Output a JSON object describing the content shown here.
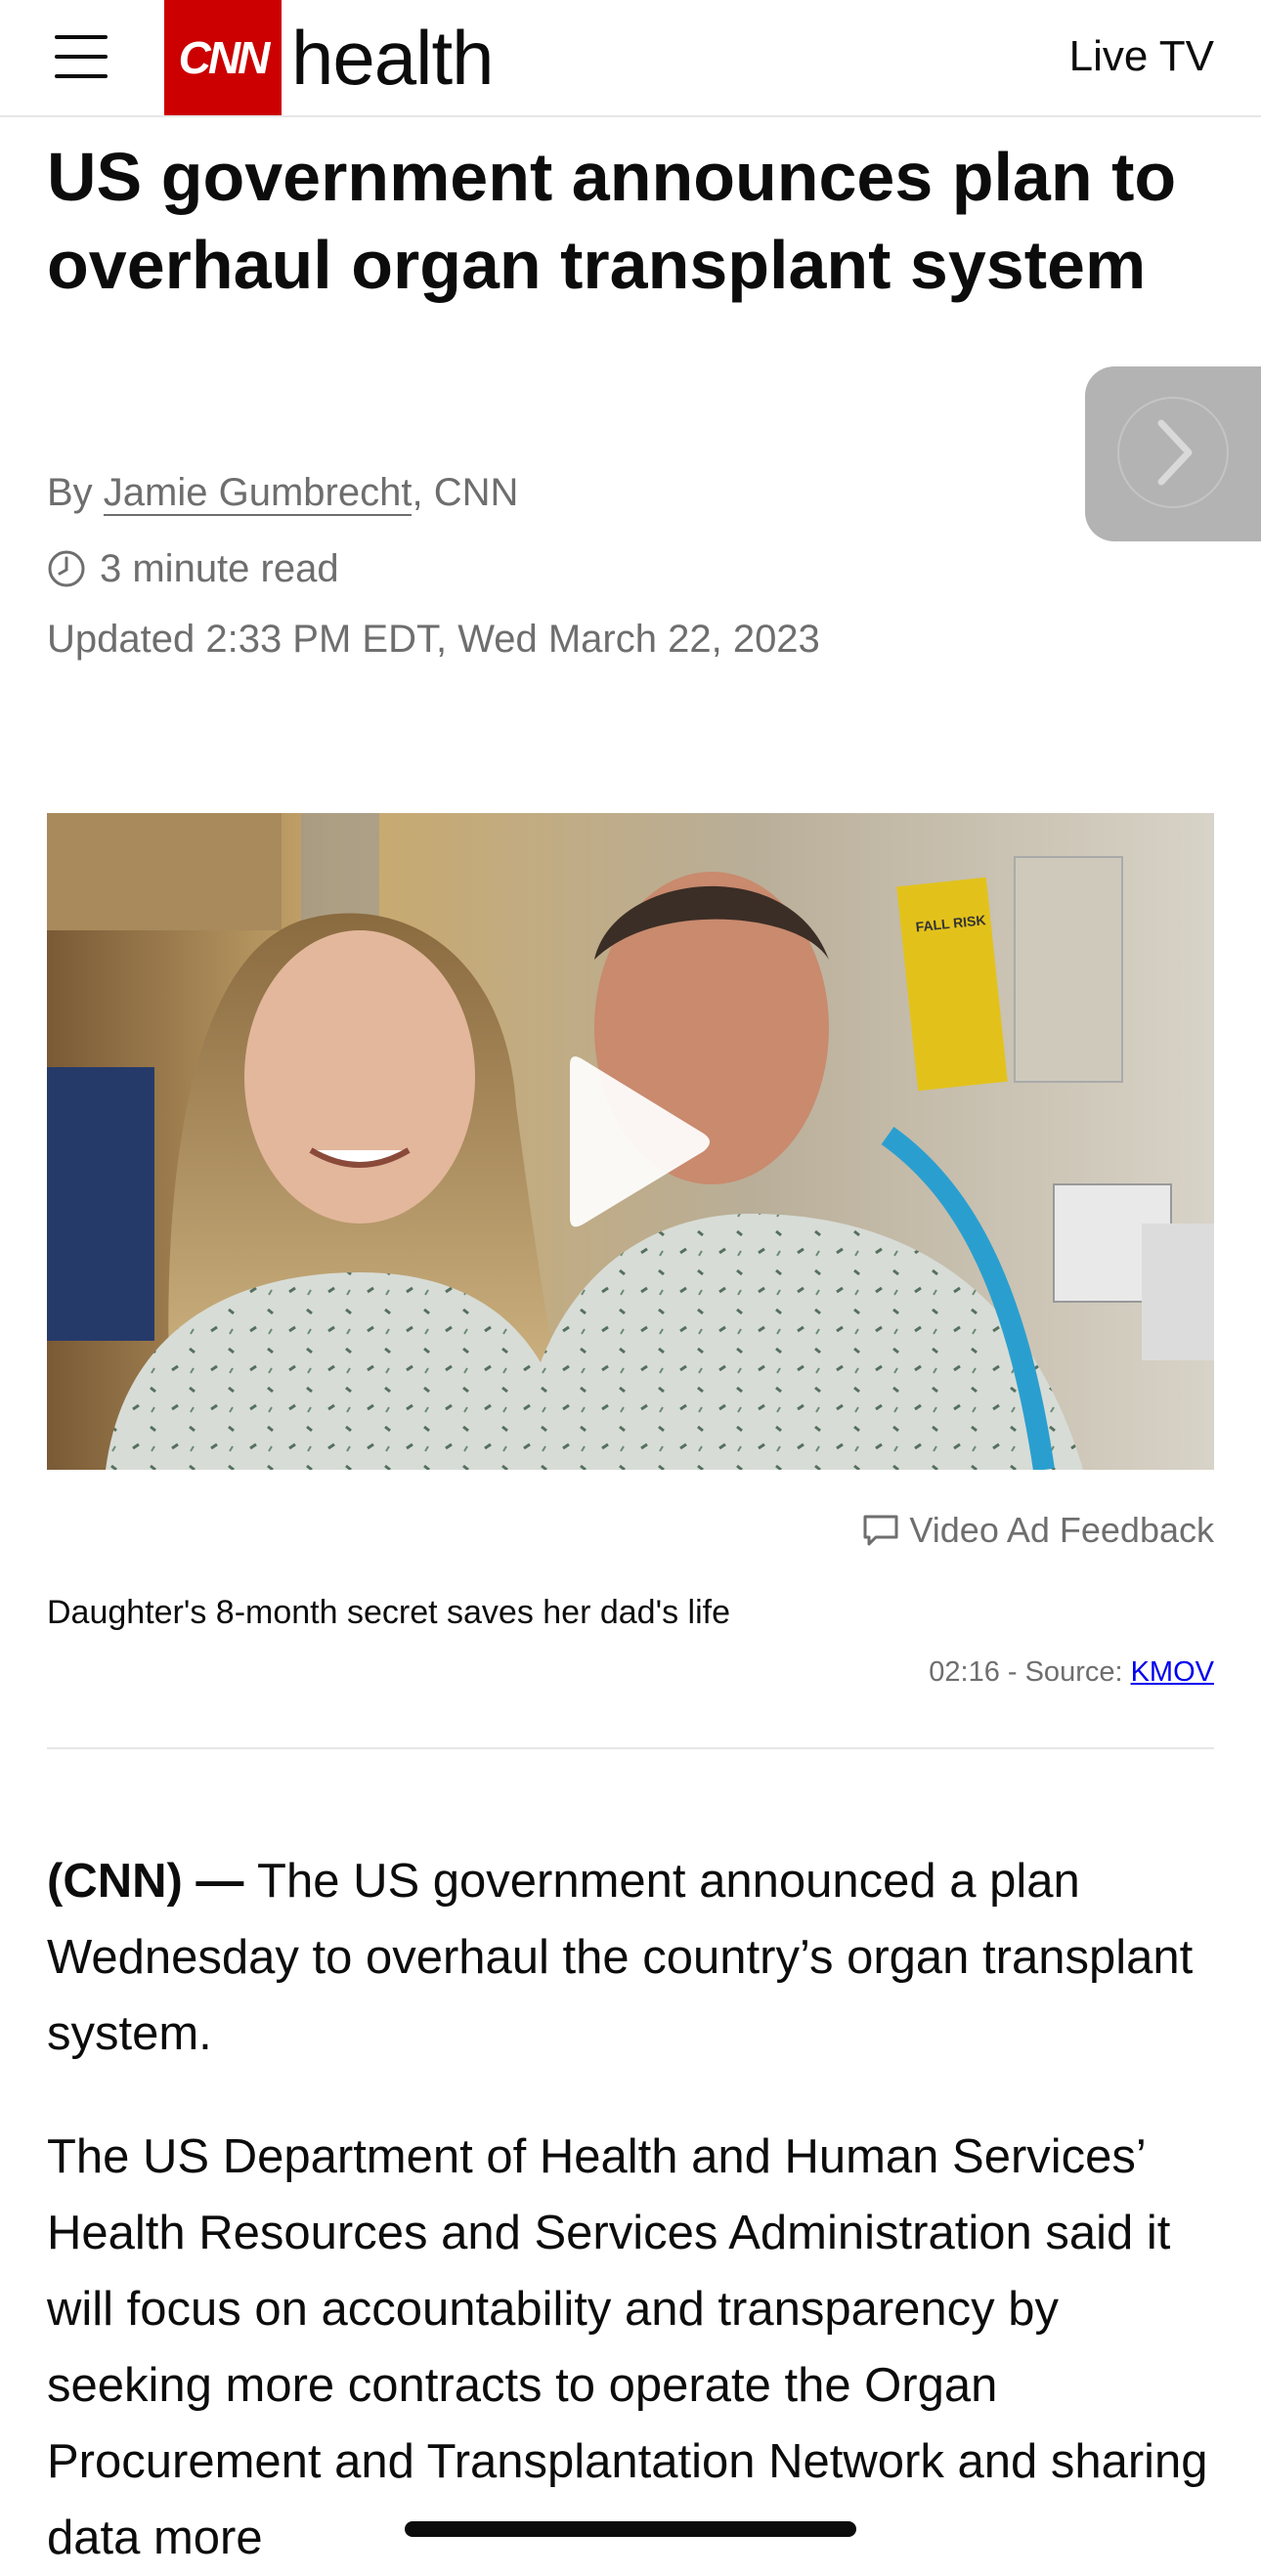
{
  "header": {
    "logo_text": "CNN",
    "section": "health",
    "live_tv": "Live TV",
    "brand_color": "#cc0000"
  },
  "article": {
    "headline": "US government announces plan to overhaul organ transplant system",
    "byline_prefix": "By ",
    "author": "Jamie Gumbrecht",
    "byline_suffix": ", CNN",
    "read_time": "3 minute read",
    "updated": "Updated 2:33 PM EDT, Wed March 22, 2023",
    "paragraphs": [
      {
        "dateline": "(CNN) — ",
        "text": "The US government announced a plan Wednesday to overhaul the country’s organ transplant system."
      },
      {
        "dateline": "",
        "text": "The US Department of Health and Human Services’ Health Resources and Services Administration said it will focus on accountability and transparency by seeking more contracts to operate the Organ Procurement and Transplantation Network and sharing data more"
      }
    ]
  },
  "video": {
    "ad_feedback": "Video Ad Feedback",
    "title": "Daughter's 8-month secret saves her dad's life",
    "duration_source": "02:16 - Source: ",
    "source_link": "KMOV",
    "sign_text": "FALL RISK"
  },
  "icons": {
    "menu": "menu-icon",
    "next": "chevron-right-icon",
    "clock": "clock-icon",
    "play": "play-icon",
    "feedback": "speech-bubble-icon"
  }
}
